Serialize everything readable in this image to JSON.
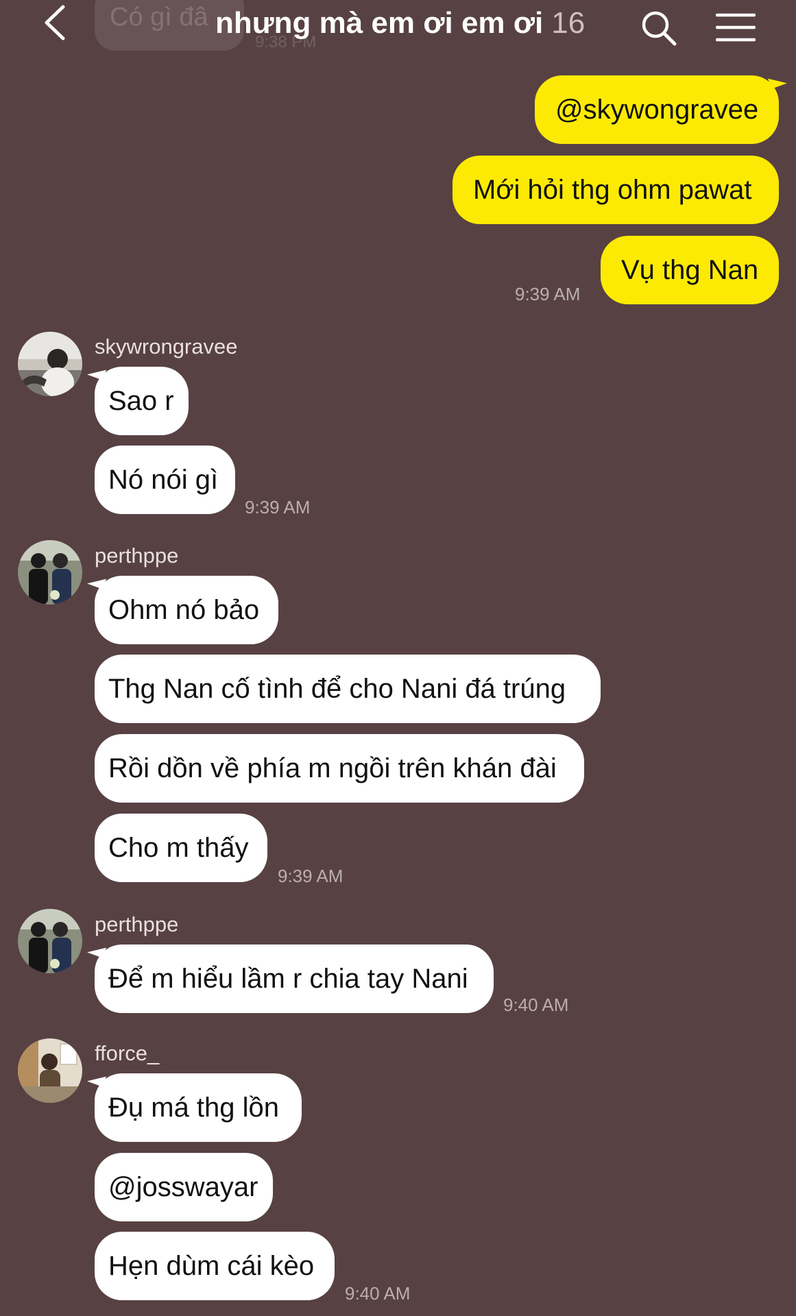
{
  "header": {
    "title": "nhưng mà em ơi em ơi",
    "member_count": "16"
  },
  "ghost_preview": {
    "text": "Có gì đâ",
    "time": "9:38 PM"
  },
  "messages": [
    {
      "side": "out",
      "bubbles": [
        "@skywongravee",
        "Mới hỏi thg ohm pawat",
        "Vụ thg Nan"
      ],
      "time": "9:39 AM"
    },
    {
      "side": "in",
      "sender": "skywrongravee",
      "avatar": "avatar-skywrongravee",
      "bubbles": [
        "Sao r",
        "Nó nói gì"
      ],
      "time": "9:39 AM"
    },
    {
      "side": "in",
      "sender": "perthppe",
      "avatar": "avatar-perthppe",
      "bubbles": [
        "Ohm nó bảo",
        "Thg Nan cố tình để cho Nani đá trúng",
        "Rồi dồn về phía m ngồi trên khán đài",
        "Cho m thấy"
      ],
      "time": "9:39 AM"
    },
    {
      "side": "in",
      "sender": "perthppe",
      "avatar": "avatar-perthppe",
      "bubbles": [
        "Để m hiểu lầm r chia tay Nani"
      ],
      "time": "9:40 AM"
    },
    {
      "side": "in",
      "sender": "fforce_",
      "avatar": "avatar-fforce",
      "bubbles": [
        "Đụ má thg lồn",
        "@josswayar",
        "Hẹn dùm cái kèo"
      ],
      "time": "9:40 AM"
    }
  ],
  "icons": {
    "back": "chevron-left-icon",
    "search": "search-icon",
    "menu": "hamburger-menu-icon"
  },
  "colors": {
    "background": "#574143",
    "outgoing_bubble": "#fcea04",
    "incoming_bubble": "#ffffff",
    "timestamp": "#bcaeae"
  }
}
